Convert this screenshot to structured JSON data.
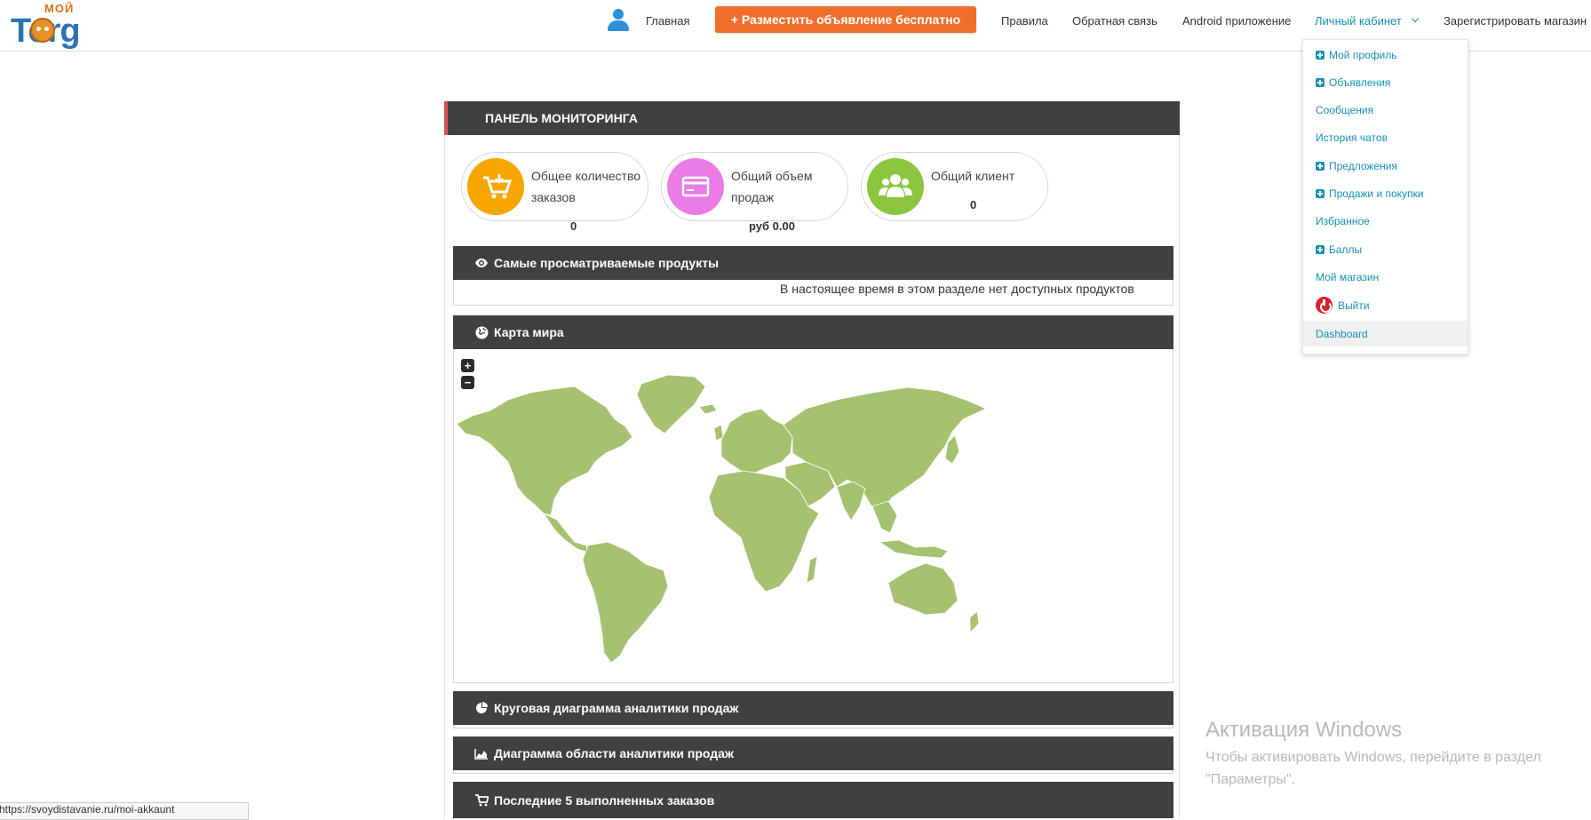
{
  "brand": {
    "top": "МОЙ",
    "name": "Torg"
  },
  "nav": {
    "home": "Главная",
    "post_ad": "+ Разместить объявление бесплатно",
    "rules": "Правила",
    "feedback": "Обратная связь",
    "android": "Android приложение",
    "cabinet": "Личный кабинет",
    "register_shop": "Зарегистрировать магазин"
  },
  "dropdown": {
    "items": [
      {
        "label": "Мой профиль",
        "icon": "plus-square-icon"
      },
      {
        "label": "Объявления",
        "icon": "plus-square-icon"
      },
      {
        "label": "Сообщения",
        "icon": ""
      },
      {
        "label": "История чатов",
        "icon": ""
      },
      {
        "label": "Предложения",
        "icon": "plus-square-icon"
      },
      {
        "label": "Продажи и покупки",
        "icon": "plus-square-icon"
      },
      {
        "label": "Избранное",
        "icon": ""
      },
      {
        "label": "Баллы",
        "icon": "plus-square-icon"
      },
      {
        "label": "Мой магазин",
        "icon": ""
      },
      {
        "label": "Выйти",
        "icon": "power-icon"
      },
      {
        "label": "Dashboard",
        "icon": ""
      }
    ],
    "active": "Dashboard"
  },
  "panel": {
    "title": "ПАНЕЛЬ МОНИТОРИНГА"
  },
  "stats": [
    {
      "label": "Общее количество заказов",
      "value": "0",
      "color": "#f7a600",
      "icon": "cart-download-icon"
    },
    {
      "label": "Общий объем продаж",
      "value": "руб 0.00",
      "color": "#ea7ce6",
      "icon": "credit-card-icon"
    },
    {
      "label": "Общий клиент",
      "value": "0",
      "color": "#8cc63e",
      "icon": "users-icon"
    }
  ],
  "sections": {
    "most_viewed": {
      "title": "Самые просматриваемые продукты",
      "empty": "В настоящее время в этом разделе нет доступных продуктов"
    },
    "world_map": {
      "title": "Карта мира",
      "zoom_in": "+",
      "zoom_out": "−"
    },
    "pie": {
      "title": "Круговая диаграмма аналитики продаж"
    },
    "area": {
      "title": "Диаграмма области аналитики продаж"
    },
    "orders": {
      "title": "Последние 5 выполненных заказов"
    }
  },
  "colors": {
    "accent": "#f06f2c",
    "link": "#1a8fb5",
    "header_dark": "#404040",
    "map_land": "#a5c271"
  },
  "watermark": {
    "title": "Активация Windows",
    "body": "Чтобы активировать Windows, перейдите в раздел \"Параметры\"."
  },
  "status_url": "https://svoydistavanie.ru/moi-akkaunt"
}
